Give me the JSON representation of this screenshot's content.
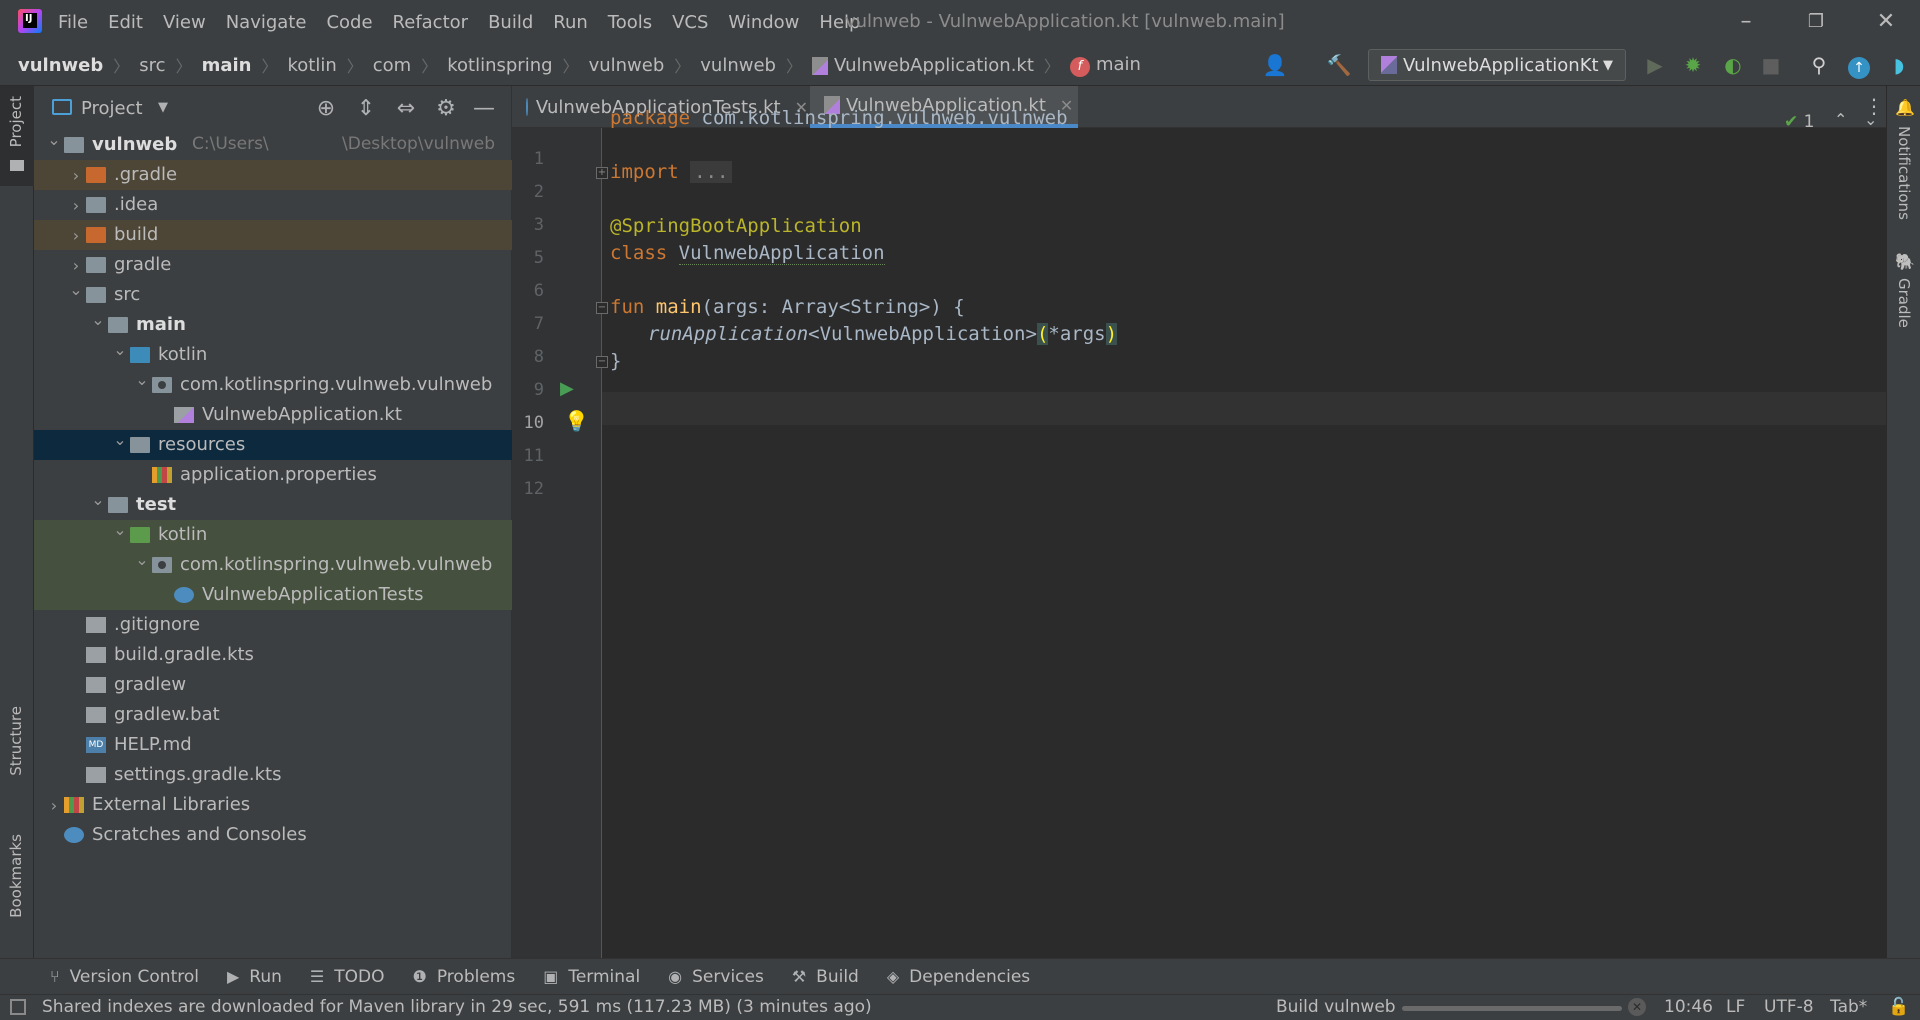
{
  "menu": [
    "File",
    "Edit",
    "View",
    "Navigate",
    "Code",
    "Refactor",
    "Build",
    "Run",
    "Tools",
    "VCS",
    "Window",
    "Help"
  ],
  "window_title": "vulnweb - VulnwebApplication.kt [vulnweb.main]",
  "breadcrumbs": [
    "vulnweb",
    "src",
    "main",
    "kotlin",
    "com",
    "kotlinspring",
    "vulnweb",
    "vulnweb",
    "VulnwebApplication.kt",
    "main"
  ],
  "run_config": "VulnwebApplicationKt",
  "left_tools": {
    "project": "Project",
    "structure": "Structure",
    "bookmarks": "Bookmarks"
  },
  "right_tools": {
    "notifications": "Notifications",
    "gradle": "Gradle"
  },
  "project_panel": {
    "title": "Project",
    "tree": [
      {
        "depth": 0,
        "arrow": "v",
        "icon": "module-folder",
        "label": "vulnweb",
        "path": "C:\\Users\\",
        "path2": "\\Desktop\\vulnweb",
        "bold": true
      },
      {
        "depth": 1,
        "arrow": ">",
        "icon": "folder-orange",
        "label": ".gradle",
        "hl": "orange"
      },
      {
        "depth": 1,
        "arrow": ">",
        "icon": "folder",
        "label": ".idea"
      },
      {
        "depth": 1,
        "arrow": ">",
        "icon": "folder-orange",
        "label": "build",
        "hl": "orange"
      },
      {
        "depth": 1,
        "arrow": ">",
        "icon": "folder",
        "label": "gradle"
      },
      {
        "depth": 1,
        "arrow": "v",
        "icon": "folder",
        "label": "src"
      },
      {
        "depth": 2,
        "arrow": "v",
        "icon": "folder",
        "label": "main",
        "bold": true
      },
      {
        "depth": 3,
        "arrow": "v",
        "icon": "folder-blue",
        "label": "kotlin"
      },
      {
        "depth": 4,
        "arrow": "v",
        "icon": "package",
        "label": "com.kotlinspring.vulnweb.vulnweb"
      },
      {
        "depth": 5,
        "arrow": "",
        "icon": "kotlin-file",
        "label": "VulnwebApplication.kt"
      },
      {
        "depth": 3,
        "arrow": "v",
        "icon": "resources-folder",
        "label": "resources",
        "hl": "selected"
      },
      {
        "depth": 4,
        "arrow": "",
        "icon": "properties-file",
        "label": "application.properties"
      },
      {
        "depth": 2,
        "arrow": "v",
        "icon": "folder",
        "label": "test",
        "bold": true
      },
      {
        "depth": 3,
        "arrow": "v",
        "icon": "folder-green",
        "label": "kotlin",
        "hl": "green"
      },
      {
        "depth": 4,
        "arrow": "v",
        "icon": "package",
        "label": "com.kotlinspring.vulnweb.vulnweb",
        "hl": "green"
      },
      {
        "depth": 5,
        "arrow": "",
        "icon": "test-file",
        "label": "VulnwebApplicationTests",
        "hl": "green"
      },
      {
        "depth": 1,
        "arrow": "",
        "icon": "gitignore-file",
        "label": ".gitignore"
      },
      {
        "depth": 1,
        "arrow": "",
        "icon": "gradle-file",
        "label": "build.gradle.kts"
      },
      {
        "depth": 1,
        "arrow": "",
        "icon": "shell-file",
        "label": "gradlew"
      },
      {
        "depth": 1,
        "arrow": "",
        "icon": "bat-file",
        "label": "gradlew.bat"
      },
      {
        "depth": 1,
        "arrow": "",
        "icon": "markdown-file",
        "label": "HELP.md"
      },
      {
        "depth": 1,
        "arrow": "",
        "icon": "gradle-file",
        "label": "settings.gradle.kts"
      },
      {
        "depth": 0,
        "arrow": ">",
        "icon": "libraries",
        "label": "External Libraries"
      },
      {
        "depth": 0,
        "arrow": "",
        "icon": "scratches",
        "label": "Scratches and Consoles"
      }
    ]
  },
  "tabs": [
    {
      "label": "VulnwebApplicationTests.kt",
      "active": false
    },
    {
      "label": "VulnwebApplication.kt",
      "active": true
    }
  ],
  "editor": {
    "inspection_count": "1",
    "line_numbers": [
      "1",
      "2",
      "3",
      "5",
      "6",
      "7",
      "8",
      "9",
      "10",
      "11",
      "12"
    ],
    "lines": {
      "l1_kw": "package",
      "l1_rest": " com.kotlinspring.vulnweb.vulnweb",
      "l3_kw": "import",
      "l3_fold": "...",
      "l6": "@SpringBootApplication",
      "l7_kw": "class",
      "l7_name": "VulnwebApplication",
      "l9_kw": "fun",
      "l9_name": "main",
      "l9_rest": "(args: Array<String>) {",
      "l10_fn": "runApplication",
      "l10_type": "<VulnwebApplication>",
      "l10_args_open": "(",
      "l10_args": "*args",
      "l10_args_close": ")",
      "l11": "}"
    }
  },
  "bottom_tools": [
    "Version Control",
    "Run",
    "TODO",
    "Problems",
    "Terminal",
    "Services",
    "Build",
    "Dependencies"
  ],
  "status": {
    "message": "Shared indexes are downloaded for Maven library in 29 sec, 591 ms (117.23 MB) (3 minutes ago)",
    "task": "Build vulnweb",
    "position": "10:46",
    "line_sep": "LF",
    "encoding": "UTF-8",
    "indent": "Tab*"
  }
}
